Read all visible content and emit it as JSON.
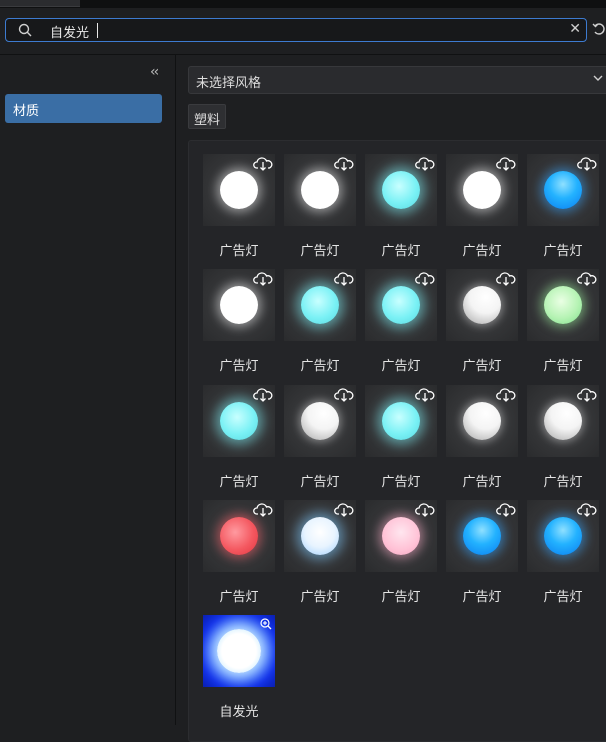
{
  "search": {
    "value": "自发光",
    "clear_icon": "close-icon"
  },
  "sidebar": {
    "collapse_icon": "double-chevron-left-icon",
    "categories": [
      {
        "label": "材质",
        "selected": true
      }
    ]
  },
  "filters": {
    "style_select": "未选择风格",
    "tags": [
      "塑料"
    ]
  },
  "colors": {
    "accent": "#3a6ea5",
    "focus_border": "#3d7bd0",
    "background": "#1e1f21"
  },
  "grid": {
    "items": [
      {
        "label": "广告灯",
        "color": "white",
        "action_icon": "cloud-download-icon"
      },
      {
        "label": "广告灯",
        "color": "white",
        "action_icon": "cloud-download-icon"
      },
      {
        "label": "广告灯",
        "color": "cyan",
        "action_icon": "cloud-download-icon"
      },
      {
        "label": "广告灯",
        "color": "white",
        "action_icon": "cloud-download-icon"
      },
      {
        "label": "广告灯",
        "color": "blue",
        "action_icon": "cloud-download-icon"
      },
      {
        "label": "广告灯",
        "color": "white",
        "action_icon": "cloud-download-icon"
      },
      {
        "label": "广告灯",
        "color": "cyan",
        "action_icon": "cloud-download-icon"
      },
      {
        "label": "广告灯",
        "color": "cyan",
        "action_icon": "cloud-download-icon"
      },
      {
        "label": "广告灯",
        "color": "silver",
        "action_icon": "cloud-download-icon"
      },
      {
        "label": "广告灯",
        "color": "green",
        "action_icon": "cloud-download-icon"
      },
      {
        "label": "广告灯",
        "color": "cyan",
        "action_icon": "cloud-download-icon"
      },
      {
        "label": "广告灯",
        "color": "silver",
        "action_icon": "cloud-download-icon"
      },
      {
        "label": "广告灯",
        "color": "cyan",
        "action_icon": "cloud-download-icon"
      },
      {
        "label": "广告灯",
        "color": "silver",
        "action_icon": "cloud-download-icon"
      },
      {
        "label": "广告灯",
        "color": "silver",
        "action_icon": "cloud-download-icon"
      },
      {
        "label": "广告灯",
        "color": "red",
        "action_icon": "cloud-download-icon"
      },
      {
        "label": "广告灯",
        "color": "paleblue",
        "action_icon": "cloud-download-icon"
      },
      {
        "label": "广告灯",
        "color": "pink",
        "action_icon": "cloud-download-icon"
      },
      {
        "label": "广告灯",
        "color": "blue",
        "action_icon": "cloud-download-icon"
      },
      {
        "label": "广告灯",
        "color": "blue",
        "action_icon": "cloud-download-icon"
      },
      {
        "label": "自发光",
        "color": "emissive",
        "action_icon": "zoom-in-icon"
      }
    ]
  }
}
